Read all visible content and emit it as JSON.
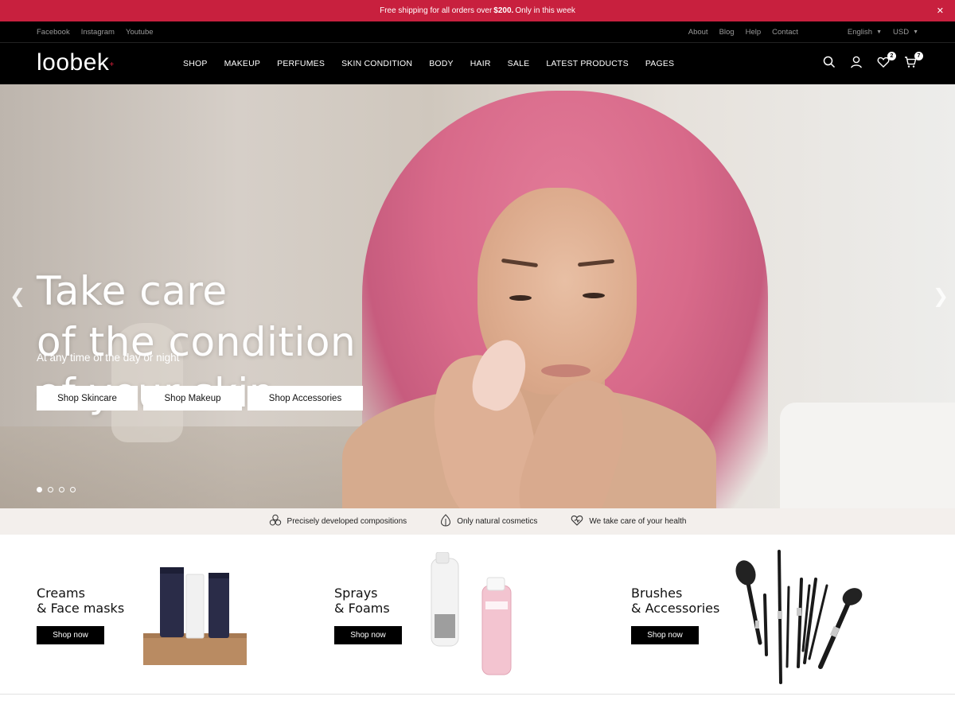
{
  "announcement": {
    "text_before": "Free shipping for all orders over",
    "amount": "$200.",
    "text_after": "Only in this week",
    "close_icon": "✕"
  },
  "utility": {
    "social": [
      "Facebook",
      "Instagram",
      "Youtube"
    ],
    "links": [
      "About",
      "Blog",
      "Help",
      "Contact"
    ],
    "language": "English",
    "currency": "USD"
  },
  "nav": {
    "logo": "loobek",
    "logo_mark": "+",
    "menu": [
      "SHOP",
      "MAKEUP",
      "PERFUMES",
      "SKIN CONDITION",
      "BODY",
      "HAIR",
      "SALE",
      "LATEST PRODUCTS",
      "PAGES"
    ],
    "wishlist_count": "2",
    "cart_count": "7",
    "icons": [
      "search-icon",
      "account-icon",
      "wishlist-icon",
      "cart-icon"
    ]
  },
  "hero": {
    "headline": [
      "Take care",
      "of the condition",
      "of your skin"
    ],
    "subtitle": "At any time of the day or night",
    "buttons": [
      "Shop Skincare",
      "Shop Makeup",
      "Shop Accessories"
    ],
    "slides": 4,
    "active_slide": 1,
    "prev": "❮",
    "next": "❯"
  },
  "features": [
    {
      "icon": "molecule-icon",
      "label": "Precisely developed compositions"
    },
    {
      "icon": "leaf-drop-icon",
      "label": "Only natural cosmetics"
    },
    {
      "icon": "heart-icon",
      "label": "We take care of your health"
    }
  ],
  "categories": [
    {
      "title": [
        "Creams",
        "& Face masks"
      ],
      "button": "Shop now"
    },
    {
      "title": [
        "Sprays",
        "& Foams"
      ],
      "button": "Shop now"
    },
    {
      "title": [
        "Brushes",
        "& Accessories"
      ],
      "button": "Shop now"
    }
  ],
  "colors": {
    "accent": "#c8203e",
    "dark": "#000000",
    "strip": "#f3efec"
  }
}
